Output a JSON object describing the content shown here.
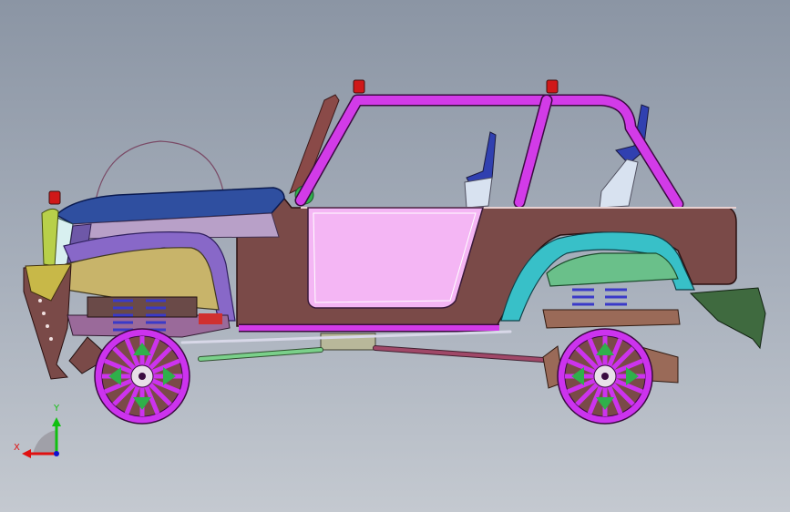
{
  "view": {
    "background_top": "#8b95a4",
    "background_bottom": "#c4c9d0"
  },
  "triad": {
    "x_label": "X",
    "y_label": "Y",
    "x_color": "#e01010",
    "y_color": "#10c010",
    "z_color": "#1010d0"
  },
  "model": {
    "body_color": "#7a4a48",
    "roll_cage_color": "#d23be8",
    "door_color": "#f4b6f4",
    "hood_color": "#2f4fa0",
    "fender_color": "#c8b46a",
    "rear_fender_color": "#6ac08a",
    "wheel_color": "#cc33ee",
    "spring_color": "#3a3ac8",
    "bumper_color": "#b8d04a",
    "rear_flap_color": "#3f6a3f",
    "seat_color": "#3040b0",
    "light_color": "#d01818"
  }
}
